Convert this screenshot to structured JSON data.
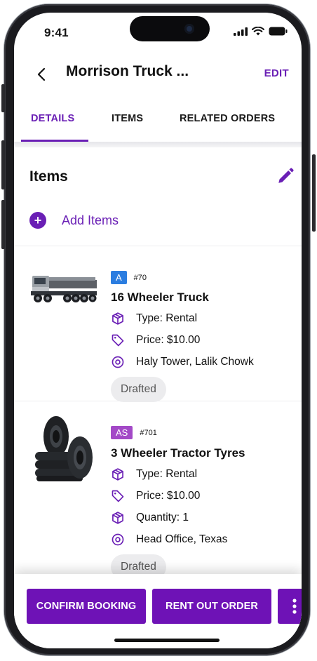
{
  "status_bar": {
    "time": "9:41"
  },
  "header": {
    "back_icon": "chevron-left-icon",
    "title": "Morrison Truck ...",
    "edit_label": "EDIT"
  },
  "tabs": [
    {
      "label": "DETAILS",
      "active": true
    },
    {
      "label": "ITEMS",
      "active": false
    },
    {
      "label": "RELATED ORDERS",
      "active": false
    }
  ],
  "items_section": {
    "title": "Items",
    "edit_icon": "pencil-icon",
    "add_label": "Add Items",
    "items": [
      {
        "badge": "A",
        "number": "#70",
        "name": "16 Wheeler Truck",
        "type": "Type: Rental",
        "price": "Price: $10.00",
        "location": "Haly Tower, Lalik Chowk",
        "status": "Drafted",
        "image": "truck-image"
      },
      {
        "badge": "AS",
        "number": "#701",
        "name": "3 Wheeler Tractor Tyres",
        "type": "Type: Rental",
        "price": "Price: $10.00",
        "quantity": "Quantity: 1",
        "location": "Head Office, Texas",
        "status": "Drafted",
        "image": "tyres-image"
      }
    ]
  },
  "actions": {
    "confirm_label": "CONFIRM BOOKING",
    "rent_out_label": "RENT OUT ORDER",
    "more_icon": "more-vertical-icon"
  },
  "colors": {
    "accent": "#6a1fb5",
    "button": "#6e12b6",
    "badge_blue": "#2b7de0",
    "badge_purple": "#a349c7"
  }
}
